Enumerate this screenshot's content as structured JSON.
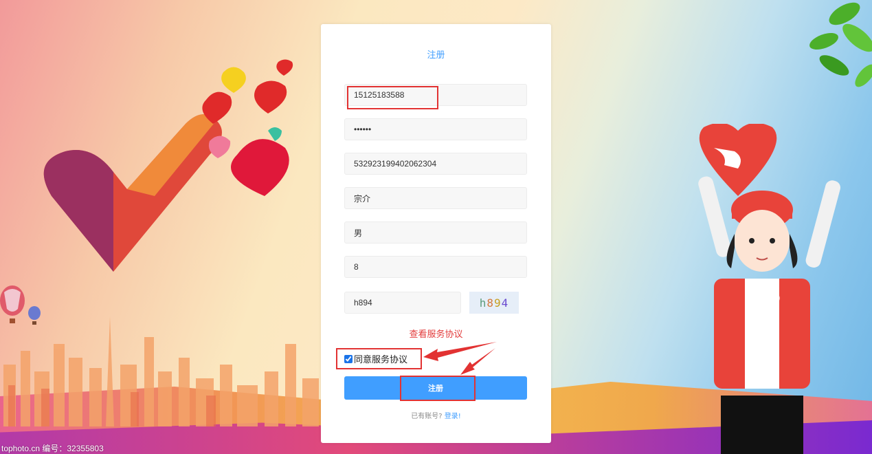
{
  "form": {
    "title": "注册",
    "phone_value": "15125183588",
    "password_value": "••••••",
    "id_number_value": "532923199402062304",
    "name_value": "宗介",
    "gender_value": "男",
    "age_value": "8",
    "captcha_input_value": "h894",
    "captcha_chars": [
      "h",
      "8",
      "9",
      "4"
    ],
    "captcha_colors": [
      "#5a9a7a",
      "#d4783a",
      "#c8a020",
      "#6a4ad0"
    ],
    "view_terms_link": "查看服务协议",
    "agree_label": "同意服务协议",
    "agree_checked": true,
    "submit_label": "注册",
    "have_account_text": "已有账号?",
    "login_link": "登录!"
  },
  "watermark": "tophoto.cn  编号：32355803",
  "colors": {
    "accent": "#409eff",
    "link_red": "#e23b3b",
    "annotation_red": "#e23232"
  }
}
